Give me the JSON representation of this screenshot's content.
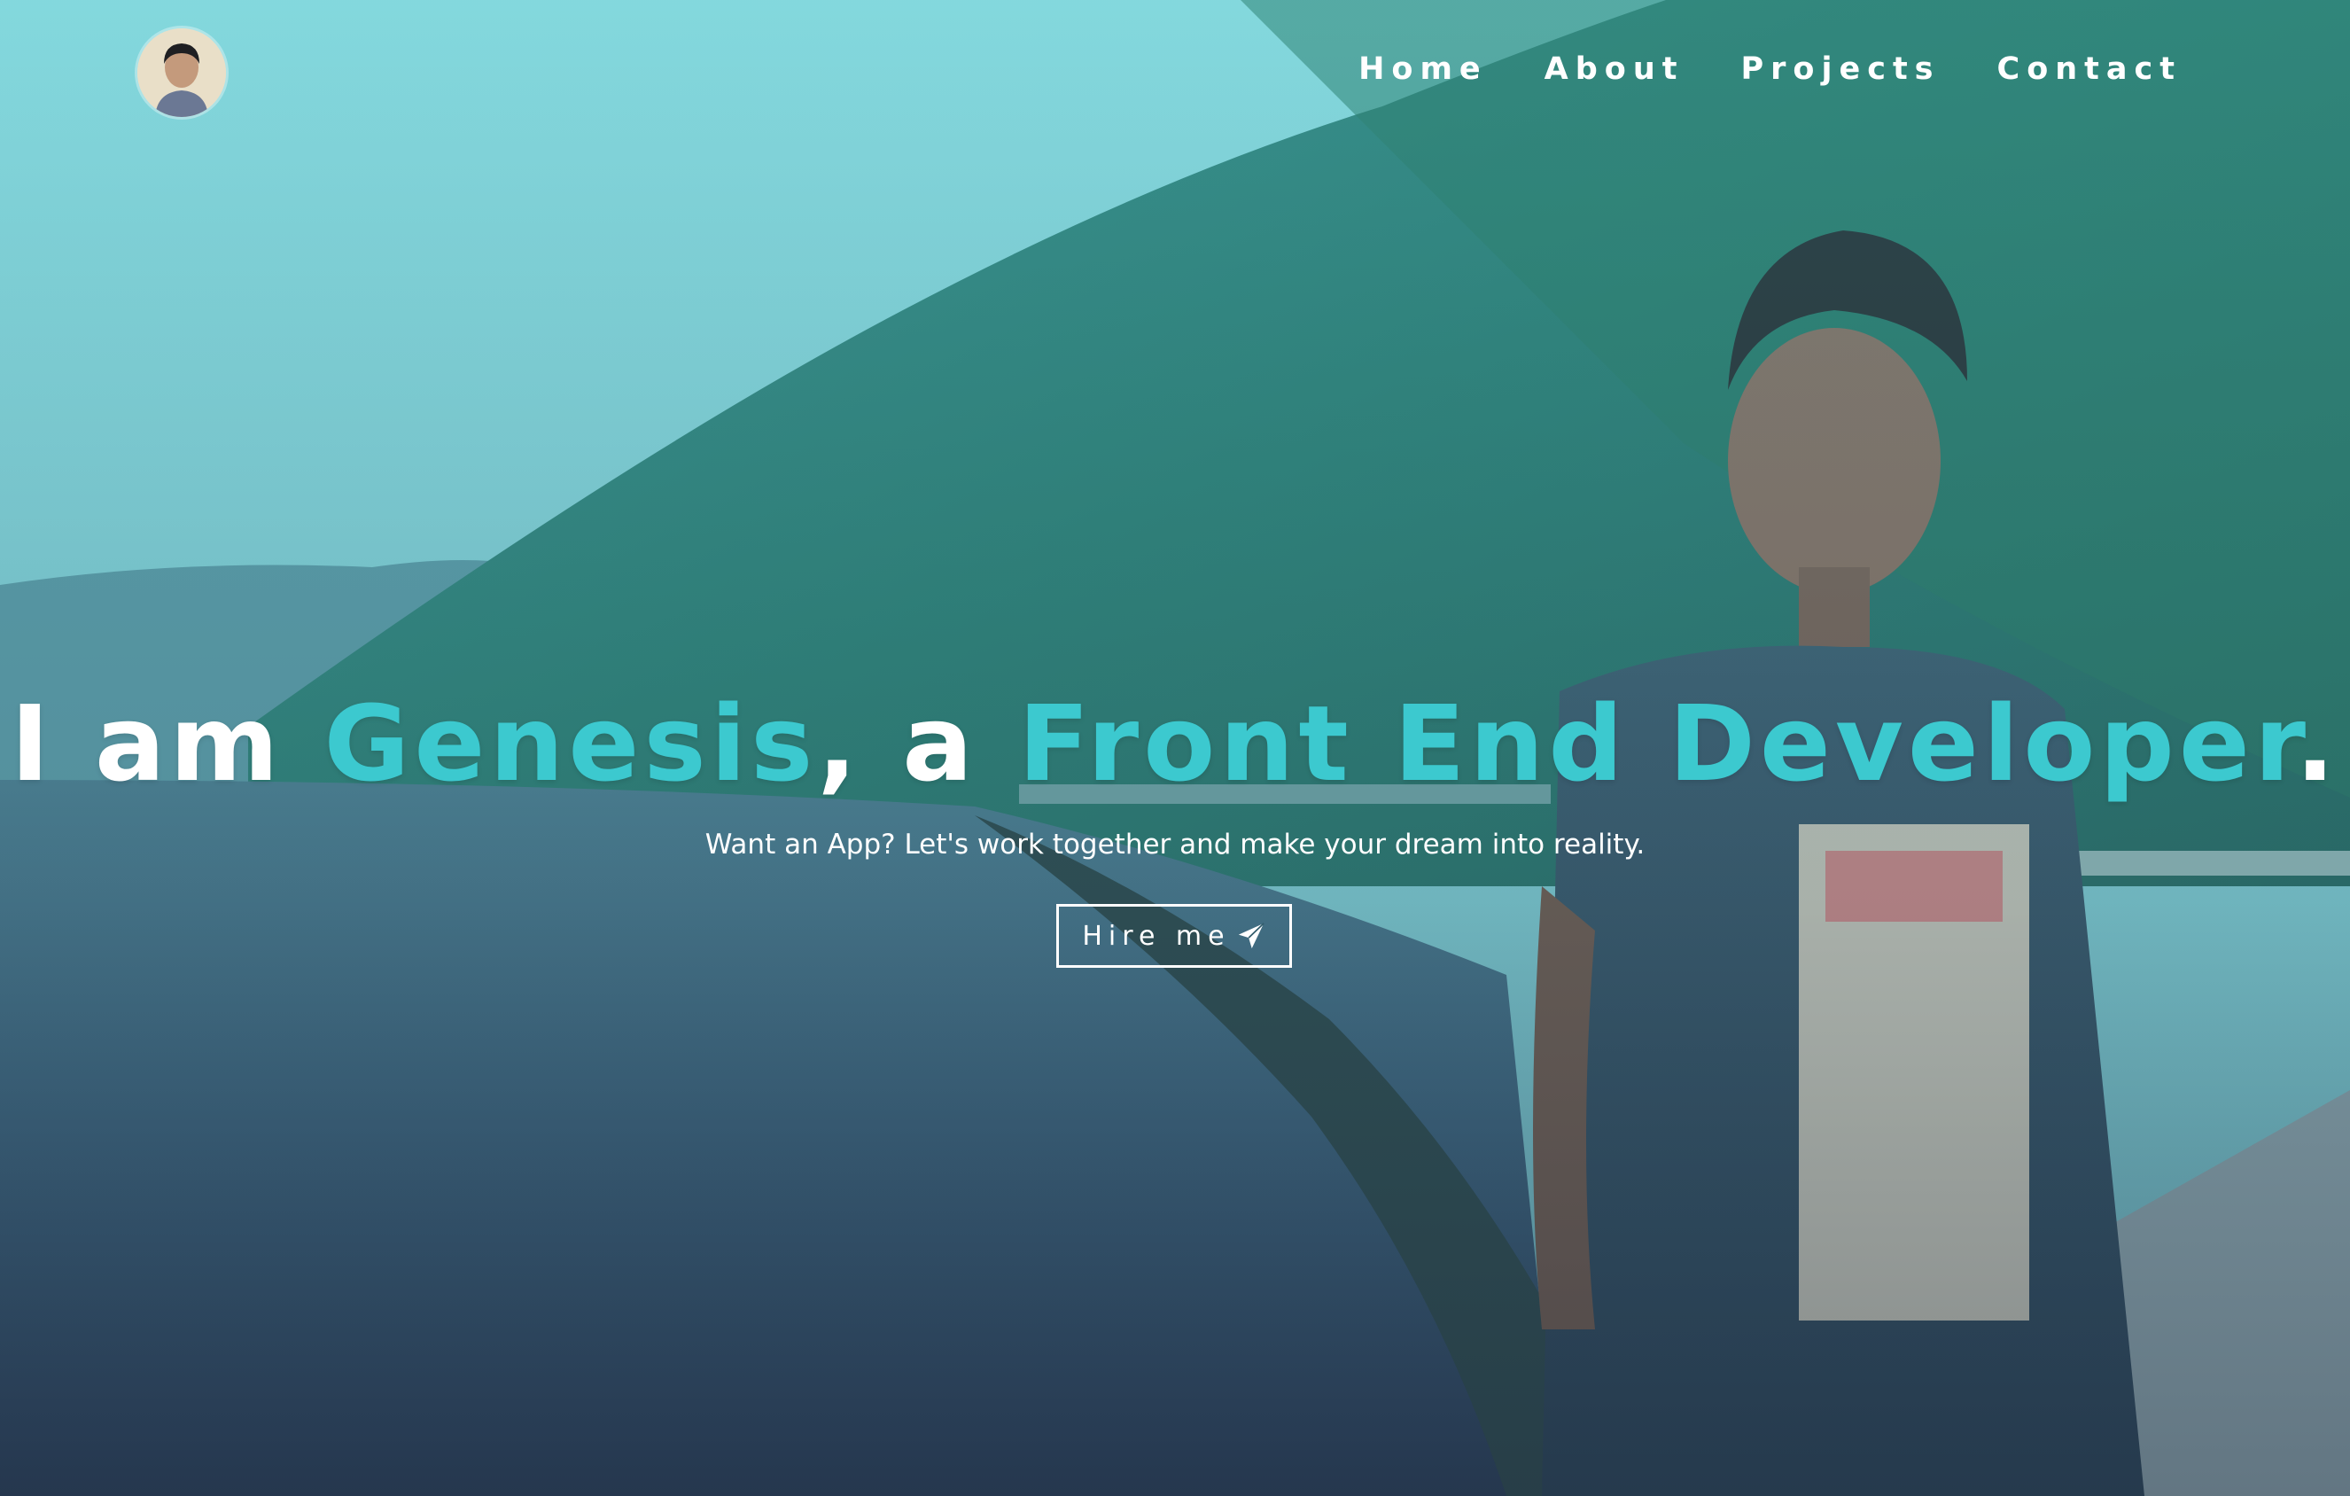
{
  "nav": {
    "avatar_alt": "profile photo",
    "links": [
      {
        "label": "Home"
      },
      {
        "label": "About"
      },
      {
        "label": "Projects"
      },
      {
        "label": "Contact"
      }
    ]
  },
  "hero": {
    "headline": {
      "part1": "I am ",
      "name": "Genesis",
      "part2": ", a ",
      "role": "Front End Developer",
      "part3": "."
    },
    "subline": "Want an App? Let's work together and make your dream into reality.",
    "cta": {
      "label": "Hire me",
      "icon": "paper-plane-icon"
    }
  },
  "colors": {
    "accent": "#3cc9cf",
    "text": "#ffffff"
  }
}
